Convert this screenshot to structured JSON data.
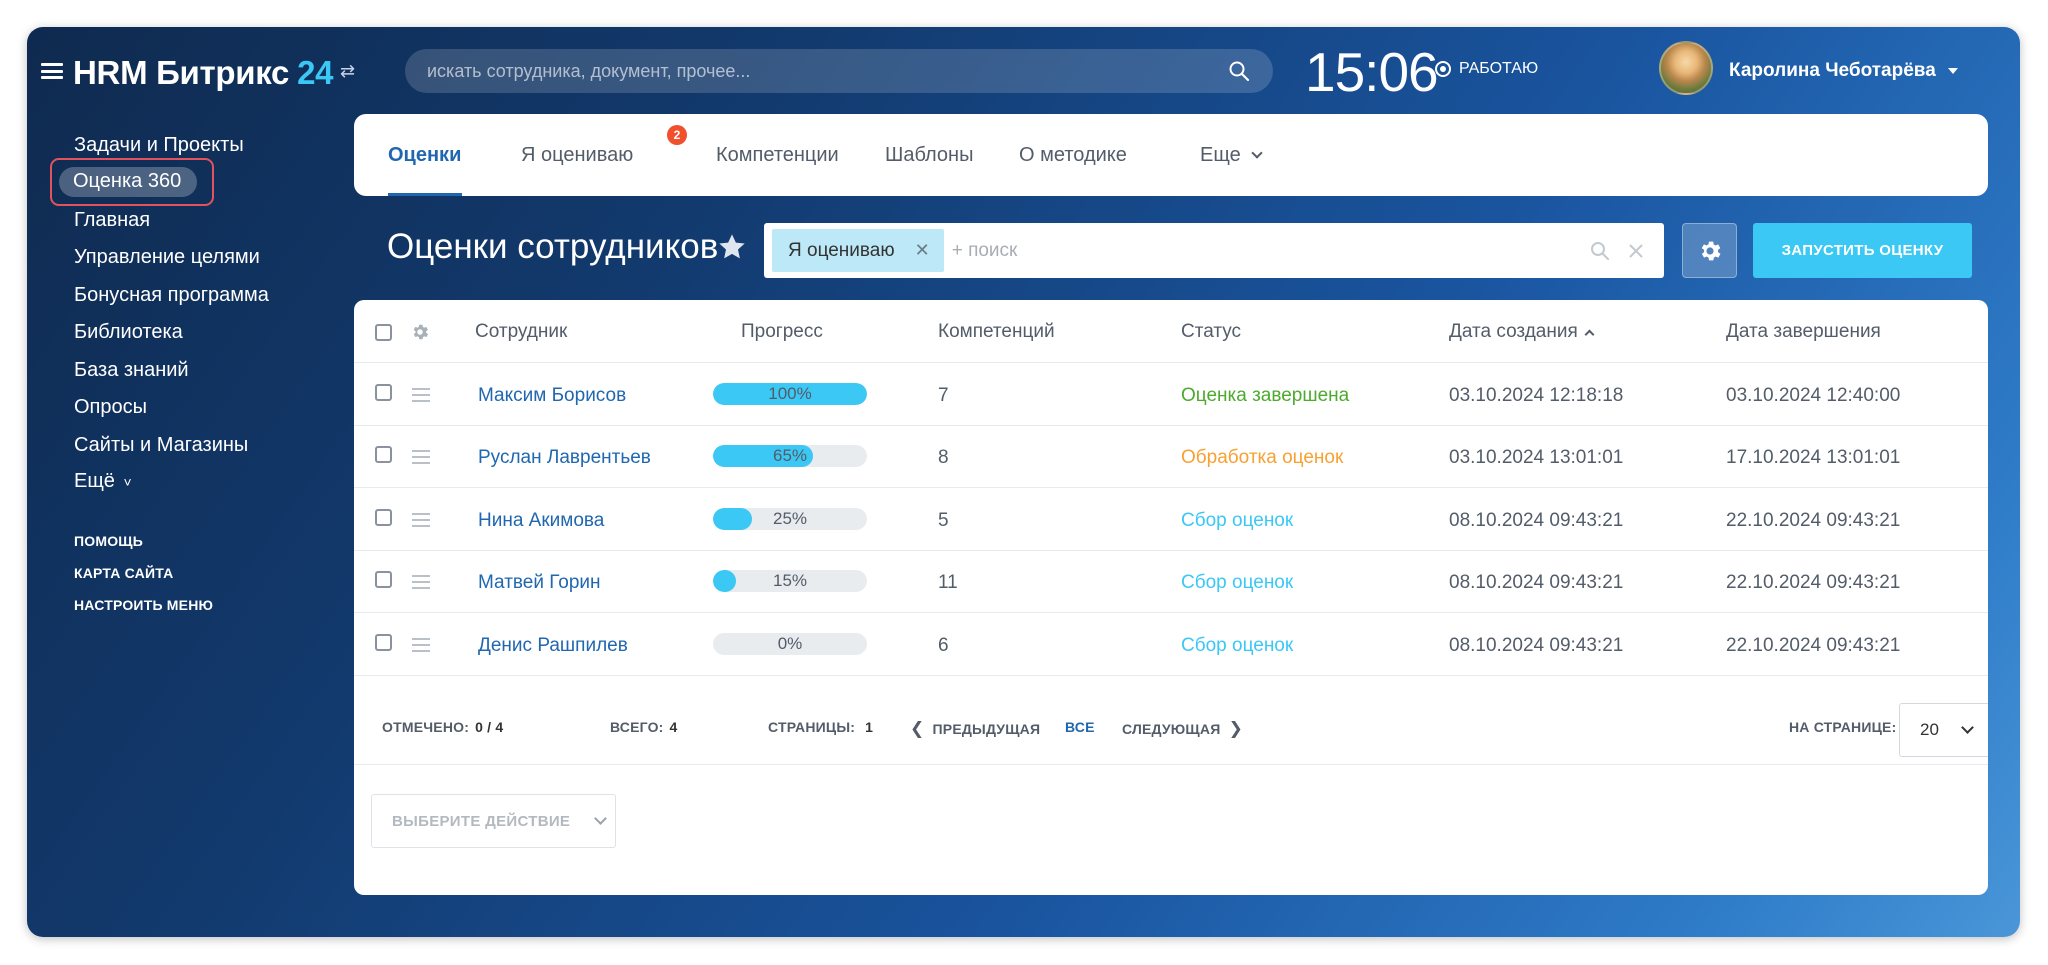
{
  "header": {
    "logo_main": "HRM Битрикс",
    "logo_num": "24",
    "search_placeholder": "искать сотрудника, документ, прочее...",
    "clock": "15:06",
    "work_status": "РАБОТАЮ",
    "user_name": "Каролина Чеботарёва"
  },
  "sidebar": {
    "items": [
      {
        "label": "Задачи и Проекты"
      },
      {
        "label": "Оценка 360",
        "active": true
      },
      {
        "label": "Главная"
      },
      {
        "label": "Управление целями"
      },
      {
        "label": "Бонусная программа"
      },
      {
        "label": "Библиотека"
      },
      {
        "label": "База знаний"
      },
      {
        "label": "Опросы"
      },
      {
        "label": "Сайты и Магазины"
      },
      {
        "label": "Ещё"
      }
    ],
    "more_caret": "˅",
    "links": [
      {
        "label": "ПОМОЩЬ"
      },
      {
        "label": "КАРТА САЙТА"
      },
      {
        "label": "НАСТРОИТЬ МЕНЮ"
      }
    ]
  },
  "tabs": {
    "items": [
      {
        "label": "Оценки",
        "active": true
      },
      {
        "label": "Я оцениваю",
        "badge": "2"
      },
      {
        "label": "Компетенции"
      },
      {
        "label": "Шаблоны"
      },
      {
        "label": "О методике"
      },
      {
        "label": "Еще"
      }
    ]
  },
  "toolbar": {
    "title": "Оценки сотрудников",
    "filter_chip": "Я оцениваю",
    "filter_placeholder": "+ поиск",
    "run_button": "ЗАПУСТИТЬ ОЦЕНКУ"
  },
  "grid": {
    "columns": [
      "Сотрудник",
      "Прогресс",
      "Компетенций",
      "Статус",
      "Дата создания",
      "Дата завершения"
    ],
    "rows": [
      {
        "name": "Максим Борисов",
        "progress": 100,
        "progress_label": "100%",
        "competencies": "7",
        "status": "Оценка завершена",
        "status_color": "#4caa2c",
        "created": "03.10.2024 12:18:18",
        "finished": "03.10.2024 12:40:00"
      },
      {
        "name": "Руслан Лаврентьев",
        "progress": 65,
        "progress_label": "65%",
        "competencies": "8",
        "status": "Обработка оценок",
        "status_color": "#f7a133",
        "created": "03.10.2024 13:01:01",
        "finished": "17.10.2024 13:01:01"
      },
      {
        "name": "Нина Акимова",
        "progress": 25,
        "progress_label": "25%",
        "competencies": "5",
        "status": "Сбор оценок",
        "status_color": "#3bc8f5",
        "created": "08.10.2024 09:43:21",
        "finished": "22.10.2024 09:43:21"
      },
      {
        "name": "Матвей Горин",
        "progress": 15,
        "progress_label": "15%",
        "competencies": "11",
        "status": "Сбор оценок",
        "status_color": "#3bc8f5",
        "created": "08.10.2024 09:43:21",
        "finished": "22.10.2024 09:43:21"
      },
      {
        "name": "Денис Рашпилев",
        "progress": 0,
        "progress_label": "0%",
        "competencies": "6",
        "status": "Сбор оценок",
        "status_color": "#3bc8f5",
        "created": "08.10.2024 09:43:21",
        "finished": "22.10.2024 09:43:21"
      }
    ]
  },
  "pager": {
    "marked_label": "ОТМЕЧЕНО:",
    "marked_value": "0 / 4",
    "total_label": "ВСЕГО:",
    "total_value": "4",
    "pages_label": "СТРАНИЦЫ:",
    "pages_value": "1",
    "prev": "ПРЕДЫДУЩАЯ",
    "all": "ВСЕ",
    "next": "СЛЕДУЮЩАЯ",
    "per_page_label": "НА СТРАНИЦЕ:",
    "per_page_value": "20"
  },
  "actions": {
    "select_action": "ВЫБЕРИТЕ ДЕЙСТВИЕ"
  },
  "colors": {
    "accent": "#3bc8f5",
    "link": "#2067b0",
    "badge": "#f2502d",
    "highlight_border": "#e2535d"
  },
  "icons": [
    "menu-icon",
    "switch-icon",
    "search-icon",
    "record-icon",
    "avatar",
    "star-icon",
    "gear-icon",
    "close-icon",
    "drag-handle-icon",
    "chevron-left-icon",
    "chevron-right-icon",
    "chevron-down-icon"
  ]
}
